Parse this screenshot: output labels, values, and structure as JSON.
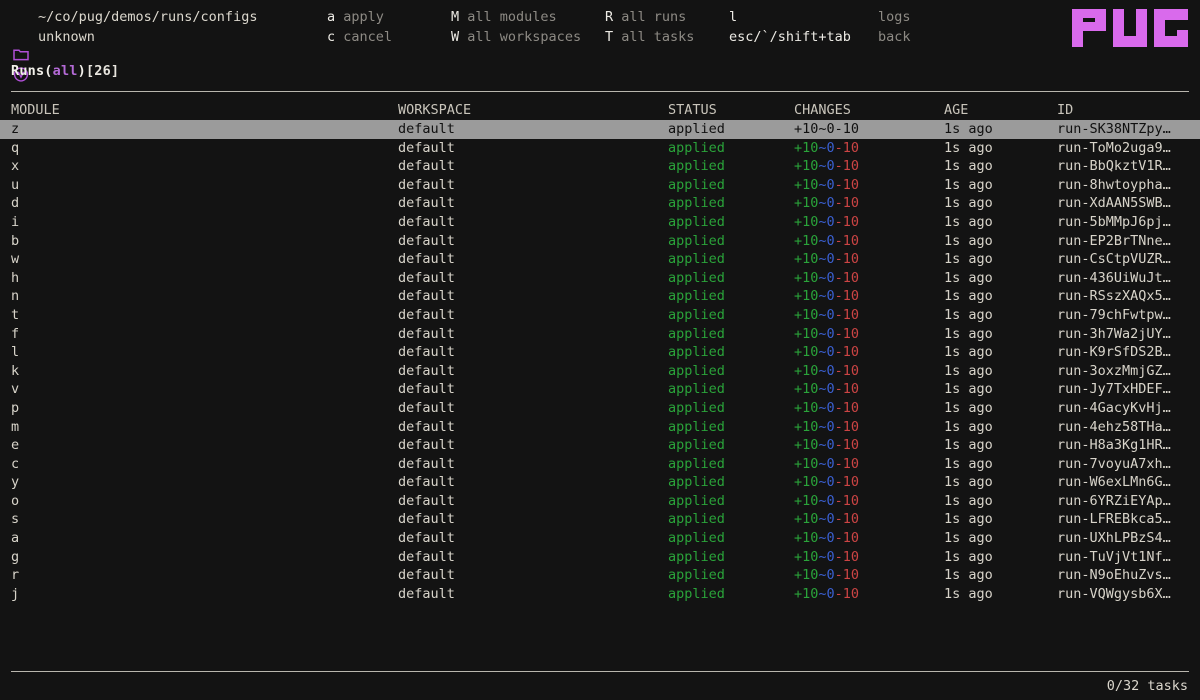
{
  "header": {
    "path_icon": "folder-icon",
    "path": "~/co/pug/demos/runs/configs",
    "version_icon": "version-circle-icon",
    "version": "unknown",
    "keybindings": [
      {
        "key": "a",
        "desc": "apply"
      },
      {
        "key": "c",
        "desc": "cancel"
      },
      {
        "key": "M",
        "desc": "all modules"
      },
      {
        "key": "W",
        "desc": "all workspaces"
      },
      {
        "key": "R",
        "desc": "all runs"
      },
      {
        "key": "T",
        "desc": "all tasks"
      },
      {
        "key": "l",
        "desc": "logs"
      },
      {
        "key": "esc/`/shift+tab",
        "desc": "back"
      }
    ],
    "logo": "PUG",
    "logo_color": "#d96aec"
  },
  "title": {
    "prefix": "Runs(",
    "filter": "all",
    "suffix": ")",
    "count": "[26]"
  },
  "table": {
    "columns": [
      "MODULE",
      "WORKSPACE",
      "STATUS",
      "CHANGES",
      "AGE",
      "ID"
    ],
    "changes_parts": {
      "added": "+10",
      "changed": "~0",
      "destroyed": "-10"
    },
    "colors": {
      "added": "#2aa33a",
      "changed": "#3a5fd0",
      "destroyed": "#cc4444",
      "status_applied": "#2aa33a",
      "selection_bg": "#9b9b9b"
    },
    "rows": [
      {
        "module": "z",
        "workspace": "default",
        "status": "applied",
        "age": "1s ago",
        "id": "run-SK38NTZpy…",
        "selected": true
      },
      {
        "module": "q",
        "workspace": "default",
        "status": "applied",
        "age": "1s ago",
        "id": "run-ToMo2uga9…",
        "selected": false
      },
      {
        "module": "x",
        "workspace": "default",
        "status": "applied",
        "age": "1s ago",
        "id": "run-BbQkztV1R…",
        "selected": false
      },
      {
        "module": "u",
        "workspace": "default",
        "status": "applied",
        "age": "1s ago",
        "id": "run-8hwtoypha…",
        "selected": false
      },
      {
        "module": "d",
        "workspace": "default",
        "status": "applied",
        "age": "1s ago",
        "id": "run-XdAAN5SWB…",
        "selected": false
      },
      {
        "module": "i",
        "workspace": "default",
        "status": "applied",
        "age": "1s ago",
        "id": "run-5bMMpJ6pj…",
        "selected": false
      },
      {
        "module": "b",
        "workspace": "default",
        "status": "applied",
        "age": "1s ago",
        "id": "run-EP2BrTNne…",
        "selected": false
      },
      {
        "module": "w",
        "workspace": "default",
        "status": "applied",
        "age": "1s ago",
        "id": "run-CsCtpVUZR…",
        "selected": false
      },
      {
        "module": "h",
        "workspace": "default",
        "status": "applied",
        "age": "1s ago",
        "id": "run-436UiWuJt…",
        "selected": false
      },
      {
        "module": "n",
        "workspace": "default",
        "status": "applied",
        "age": "1s ago",
        "id": "run-RSszXAQx5…",
        "selected": false
      },
      {
        "module": "t",
        "workspace": "default",
        "status": "applied",
        "age": "1s ago",
        "id": "run-79chFwtpw…",
        "selected": false
      },
      {
        "module": "f",
        "workspace": "default",
        "status": "applied",
        "age": "1s ago",
        "id": "run-3h7Wa2jUY…",
        "selected": false
      },
      {
        "module": "l",
        "workspace": "default",
        "status": "applied",
        "age": "1s ago",
        "id": "run-K9rSfDS2B…",
        "selected": false
      },
      {
        "module": "k",
        "workspace": "default",
        "status": "applied",
        "age": "1s ago",
        "id": "run-3oxzMmjGZ…",
        "selected": false
      },
      {
        "module": "v",
        "workspace": "default",
        "status": "applied",
        "age": "1s ago",
        "id": "run-Jy7TxHDEF…",
        "selected": false
      },
      {
        "module": "p",
        "workspace": "default",
        "status": "applied",
        "age": "1s ago",
        "id": "run-4GacyKvHj…",
        "selected": false
      },
      {
        "module": "m",
        "workspace": "default",
        "status": "applied",
        "age": "1s ago",
        "id": "run-4ehz58THa…",
        "selected": false
      },
      {
        "module": "e",
        "workspace": "default",
        "status": "applied",
        "age": "1s ago",
        "id": "run-H8a3Kg1HR…",
        "selected": false
      },
      {
        "module": "c",
        "workspace": "default",
        "status": "applied",
        "age": "1s ago",
        "id": "run-7voyuA7xh…",
        "selected": false
      },
      {
        "module": "y",
        "workspace": "default",
        "status": "applied",
        "age": "1s ago",
        "id": "run-W6exLMn6G…",
        "selected": false
      },
      {
        "module": "o",
        "workspace": "default",
        "status": "applied",
        "age": "1s ago",
        "id": "run-6YRZiEYAp…",
        "selected": false
      },
      {
        "module": "s",
        "workspace": "default",
        "status": "applied",
        "age": "1s ago",
        "id": "run-LFREBkca5…",
        "selected": false
      },
      {
        "module": "a",
        "workspace": "default",
        "status": "applied",
        "age": "1s ago",
        "id": "run-UXhLPBzS4…",
        "selected": false
      },
      {
        "module": "g",
        "workspace": "default",
        "status": "applied",
        "age": "1s ago",
        "id": "run-TuVjVt1Nf…",
        "selected": false
      },
      {
        "module": "r",
        "workspace": "default",
        "status": "applied",
        "age": "1s ago",
        "id": "run-N9oEhuZvs…",
        "selected": false
      },
      {
        "module": "j",
        "workspace": "default",
        "status": "applied",
        "age": "1s ago",
        "id": "run-VQWgysb6X…",
        "selected": false
      }
    ]
  },
  "footer": {
    "tasks": "0/32 tasks"
  }
}
